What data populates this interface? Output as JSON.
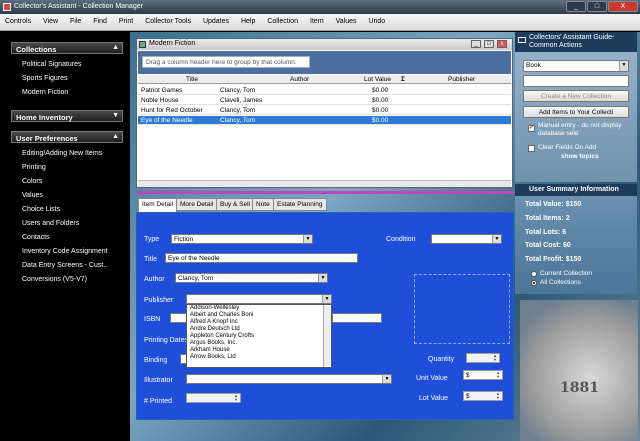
{
  "window": {
    "title": "Collector's Assistant - Collection Manager",
    "min": "_",
    "max": "□",
    "close": "X"
  },
  "menu": [
    "Controls",
    "View",
    "File",
    "Find",
    "Print",
    "Collector Tools",
    "Updates",
    "Help",
    "Collection",
    "Item",
    "Values",
    "Undo"
  ],
  "sidebar": {
    "collections": {
      "title": "Collections",
      "items": [
        "Political Signatures",
        "Sports Figures",
        "Modern Fiction"
      ]
    },
    "home_inventory": {
      "title": "Home Inventory"
    },
    "preferences": {
      "title": "User Preferences",
      "items": [
        "Editing/Adding New Items",
        "Printing",
        "Colors",
        "Values",
        "Choice Lists",
        "Users and Folders",
        "Contacts",
        "Inventory Code Assignment",
        "Data Entry Screens - Cust..",
        "Conversions (V5-V7)"
      ]
    }
  },
  "grid": {
    "title": "Modern Fiction",
    "group_hint": "Drag a column header here to group by that column.",
    "columns": [
      "Title",
      "Author",
      "Lot Value",
      "Σ",
      "Publisher"
    ],
    "rows": [
      {
        "title": "Patriot Games",
        "author": "Clancy, Tom",
        "value": "$0.00"
      },
      {
        "title": "Noble House",
        "author": "Clavell, James",
        "value": "$0.00"
      },
      {
        "title": "Hunt for Red October",
        "author": "Clancy, Tom",
        "value": "$0.00"
      },
      {
        "title": "Eye of the Needle",
        "author": "Clancy, Tom",
        "value": "$0.00"
      }
    ]
  },
  "tabs": [
    "Item Detail",
    "More Detail",
    "Buy & Sell",
    "Note",
    "Estate Planning"
  ],
  "form": {
    "type_label": "Type",
    "type_value": "Fiction",
    "condition_label": "Condition",
    "condition_value": "",
    "title_label": "Title",
    "title_value": "Eye of the Needle",
    "author_label": "Author",
    "author_value": "Clancy, Tom",
    "publisher_label": "Publisher",
    "publisher_value": "",
    "isbn_label": "ISBN",
    "printing_label": "Printing Dates",
    "binding_label": "Binding",
    "quantity_label": "Quantity",
    "quantity_value": "",
    "illustrator_label": "Illustrator",
    "unit_value_label": "Unit Value",
    "unit_value": "$",
    "printed_label": "# Printed",
    "lot_value_label": "Lot Value",
    "lot_value": "$"
  },
  "publishers": [
    "Addison-Wellesley",
    "Albert and Charles Boni",
    "Alfred A Knopf Inc",
    "Andre Deutsch Ltd",
    "Appleton Century Crofts",
    "Argus Books, Inc.",
    "Arkham House",
    "Arrow Books, Ltd"
  ],
  "guide": {
    "title": "Collectors' Assistant Guide- Common Actions",
    "select_value": "Book",
    "create_btn": "Create a New Collection",
    "add_btn": "Add Items to Your Collecti",
    "manual_text": "Manual entry - do not display database sele",
    "clear_text": "Clear Fields On Add",
    "show_topics": "show topics"
  },
  "summary": {
    "title": "User Summary Information",
    "stats": [
      "Total Value: $150",
      "Total Items: 2",
      "Total Lots: 6",
      "Total Cost: $0",
      "Total Profit: $150"
    ],
    "radio_current": "Current Collection",
    "radio_all": "All Collections"
  },
  "coin": {
    "year": "1881"
  },
  "colors": {
    "panel": "#1f4fd8",
    "selected_row": "#2e7bd6",
    "header": "#4d6f9d"
  }
}
